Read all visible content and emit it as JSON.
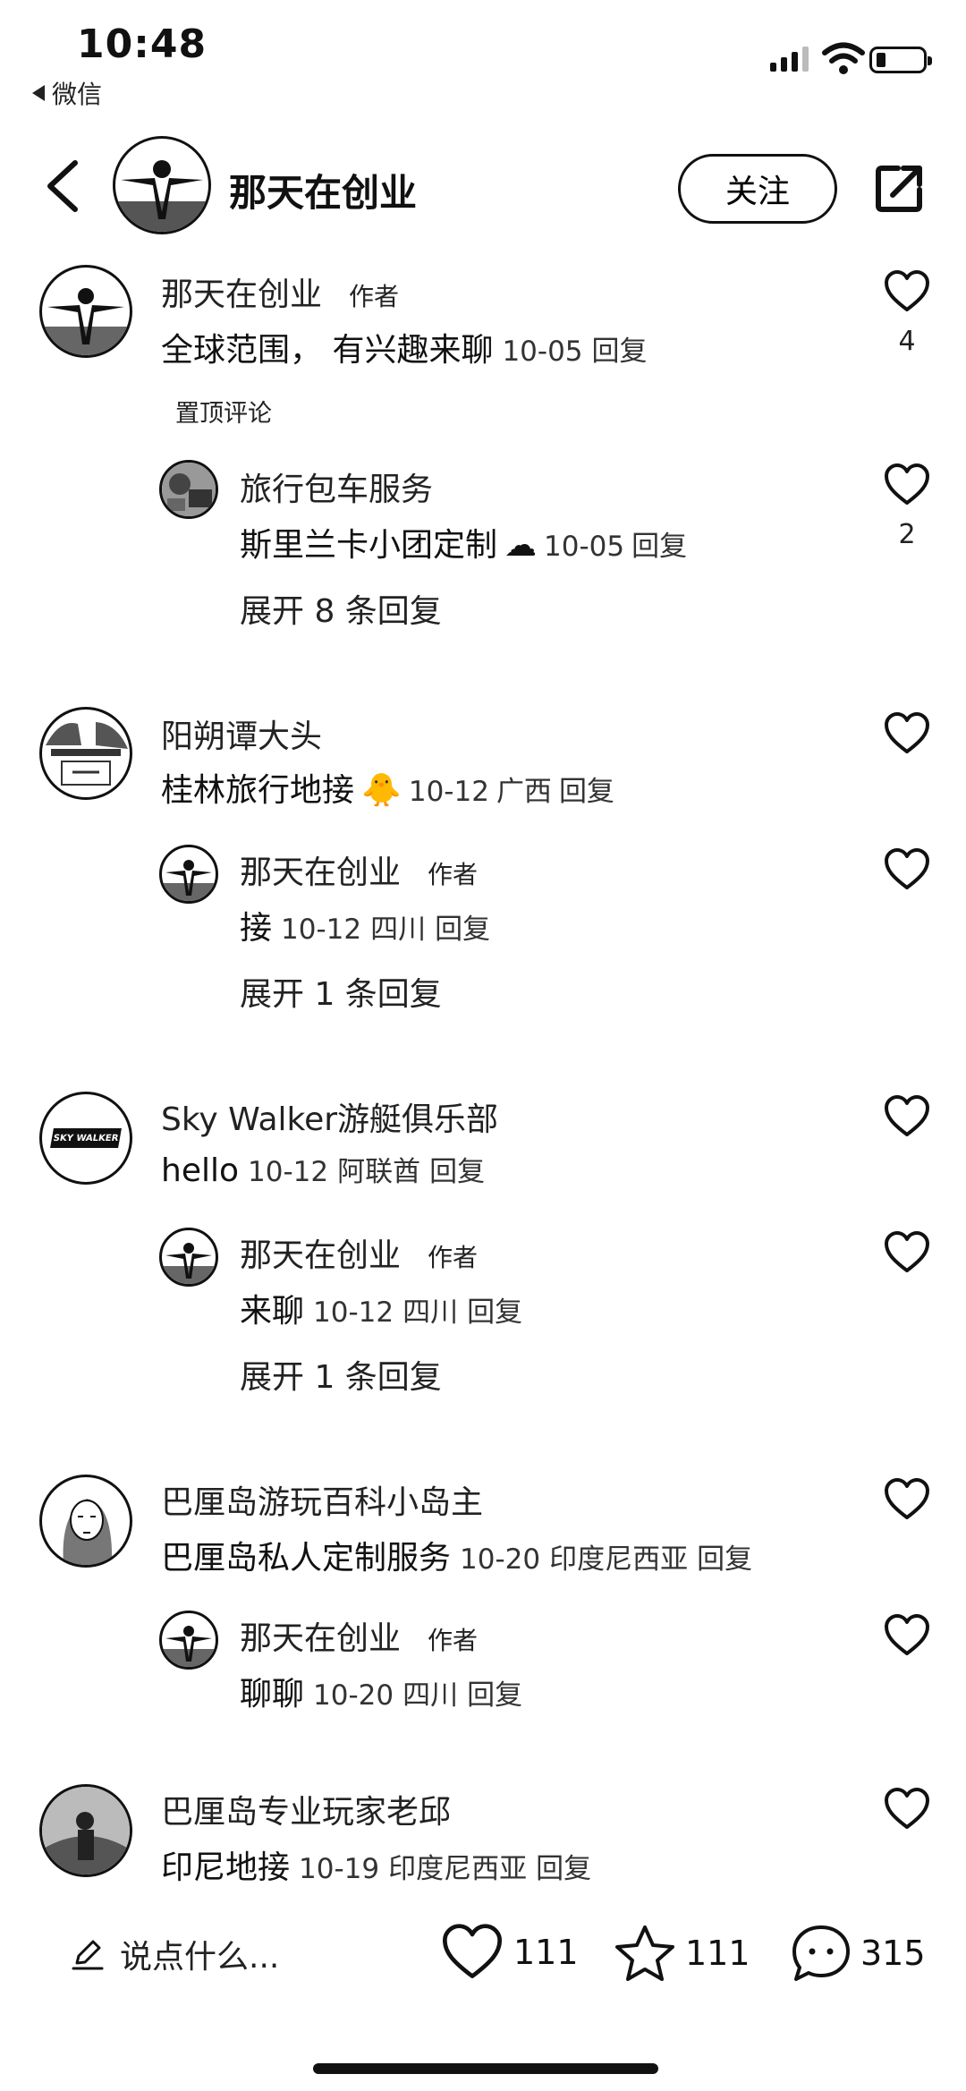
{
  "status": {
    "time": "10:48",
    "back_app": "微信"
  },
  "header": {
    "title": "那天在创业",
    "follow_label": "关注"
  },
  "comments": [
    {
      "user": "那天在创业",
      "tag": "作者",
      "text": "全球范围， 有兴趣来聊",
      "date": "10-05",
      "location": "",
      "reply_label": "回复",
      "likes": "4",
      "pinned": "置顶评论",
      "replies": [
        {
          "user": "旅行包车服务",
          "tag": "",
          "text": "斯里兰卡小团定制",
          "emoji": "☁",
          "date": "10-05",
          "location": "",
          "reply_label": "回复",
          "likes": "2"
        }
      ],
      "expand": "展开 8 条回复"
    },
    {
      "user": "阳朔谭大头",
      "tag": "",
      "text": "桂林旅行地接",
      "emoji": "🐥",
      "date": "10-12",
      "location": "广西",
      "reply_label": "回复",
      "replies": [
        {
          "user": "那天在创业",
          "tag": "作者",
          "text": "接",
          "date": "10-12",
          "location": "四川",
          "reply_label": "回复"
        }
      ],
      "expand": "展开 1 条回复"
    },
    {
      "user": "Sky Walker游艇俱乐部",
      "tag": "",
      "text": "hello",
      "date": "10-12",
      "location": "阿联酋",
      "reply_label": "回复",
      "avatar_text": "SKY WALKER",
      "replies": [
        {
          "user": "那天在创业",
          "tag": "作者",
          "text": "来聊",
          "date": "10-12",
          "location": "四川",
          "reply_label": "回复"
        }
      ],
      "expand": "展开 1 条回复"
    },
    {
      "user": "巴厘岛游玩百科小岛主",
      "tag": "",
      "text": "巴厘岛私人定制服务",
      "date": "10-20",
      "location": "印度尼西亚",
      "reply_label": "回复",
      "replies": [
        {
          "user": "那天在创业",
          "tag": "作者",
          "text": "聊聊",
          "date": "10-20",
          "location": "四川",
          "reply_label": "回复"
        }
      ]
    },
    {
      "user": "巴厘岛专业玩家老邱",
      "tag": "",
      "text": "印尼地接",
      "date": "10-19",
      "location": "印度尼西亚",
      "reply_label": "回复"
    }
  ],
  "bottom_bar": {
    "input_placeholder": "说点什么...",
    "likes": "111",
    "favorites": "111",
    "comments": "315"
  },
  "icons": [
    "back-chevron-icon",
    "share-icon",
    "heart-icon",
    "edit-pencil-icon",
    "star-icon",
    "chat-bubble-icon"
  ]
}
